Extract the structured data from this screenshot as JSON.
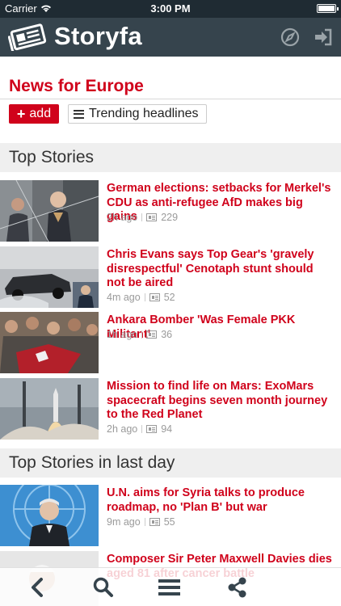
{
  "status_bar": {
    "carrier": "Carrier",
    "time": "3:00 PM"
  },
  "header": {
    "title": "Storyfa",
    "icons": [
      "compass-icon",
      "sign-in-icon"
    ]
  },
  "page": {
    "title": "News for Europe",
    "add_label": "add",
    "trending_label": "Trending headlines"
  },
  "sections": [
    {
      "title": "Top Stories",
      "stories": [
        {
          "title": "German elections: setbacks for Merkel's CDU as anti-refugee AfD makes big gains",
          "time": "2h ago",
          "count": "229"
        },
        {
          "title": "Chris Evans says Top Gear's 'gravely disrespectful' Cenotaph stunt should not be aired",
          "time": "4m ago",
          "count": "52"
        },
        {
          "title": "Ankara Bomber 'Was Female PKK Militant'",
          "time": "1h ago",
          "count": "36"
        },
        {
          "title": "Mission to find life on Mars: ExoMars spacecraft begins seven month journey to the Red Planet",
          "time": "2h ago",
          "count": "94"
        }
      ]
    },
    {
      "title": "Top Stories in last day",
      "stories": [
        {
          "title": "U.N. aims for Syria talks to produce roadmap, no 'Plan B' but war",
          "time": "9m ago",
          "count": "55"
        },
        {
          "title": "Composer Sir Peter Maxwell Davies dies aged 81 after cancer battle",
          "time": "",
          "count": ""
        }
      ]
    }
  ],
  "toolbar": {
    "icons": [
      "back-icon",
      "search-icon",
      "menu-icon",
      "share-icon"
    ]
  },
  "colors": {
    "accent": "#d0021b",
    "header_bg": "#36444d",
    "section_bg": "#efefef"
  }
}
